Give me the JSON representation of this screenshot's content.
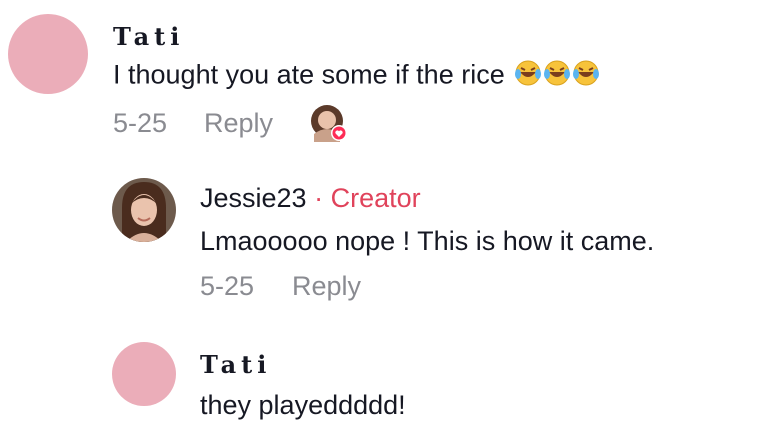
{
  "comments": [
    {
      "username": "Tati",
      "text": "I thought you ate some if the rice",
      "emojis": "😂😂😂",
      "date": "5-25",
      "reply_label": "Reply"
    },
    {
      "username": "Jessie23",
      "creator_tag": "· Creator",
      "text": "Lmaooooo nope ! This is how it came.",
      "date": "5-25",
      "reply_label": "Reply"
    },
    {
      "username": "Tati",
      "text": "they playeddddd!"
    }
  ],
  "colors": {
    "avatar_pink": "#ebadb9",
    "creator_accent": "#e0435b",
    "meta_gray": "#8a8b91",
    "heart_badge": "#fe2c55"
  }
}
